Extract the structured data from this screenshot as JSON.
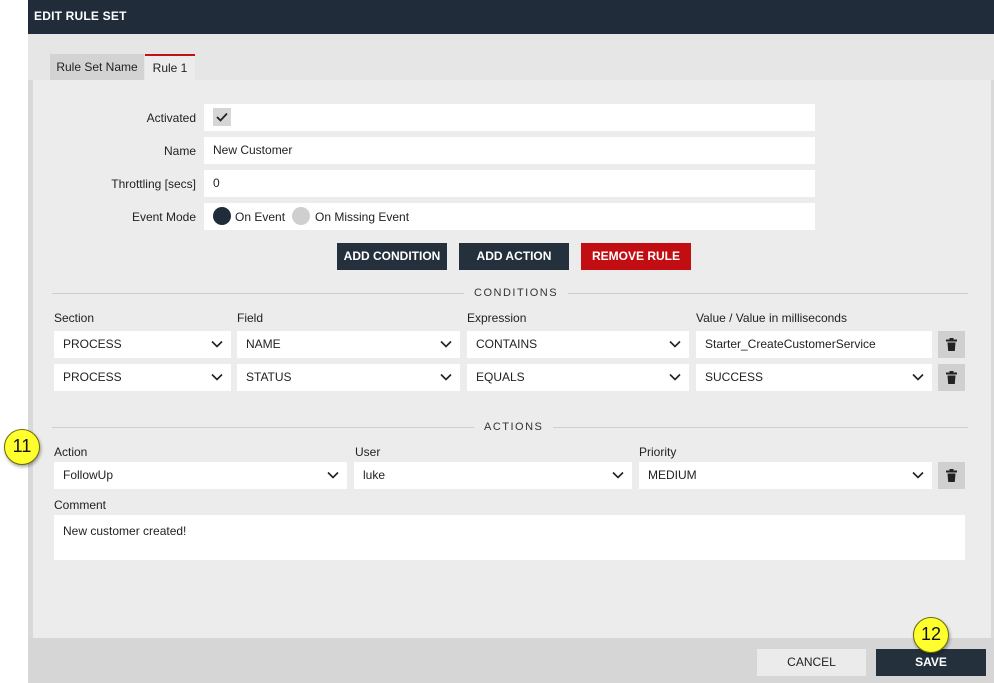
{
  "dialog": {
    "title": "EDIT RULE SET"
  },
  "tabs": [
    {
      "label": "Rule Set Name"
    },
    {
      "label": "Rule 1"
    }
  ],
  "rule": {
    "activated_label": "Activated",
    "name_label": "Name",
    "name_value": "New Customer",
    "throttling_label": "Throttling [secs]",
    "throttling_value": "0",
    "event_mode_label": "Event Mode",
    "event_mode_options": [
      "On Event",
      "On Missing Event"
    ]
  },
  "buttons": {
    "add_condition": "ADD CONDITION",
    "add_action": "ADD ACTION",
    "remove_rule": "REMOVE RULE"
  },
  "conditions": {
    "title": "CONDITIONS",
    "headers": {
      "section": "Section",
      "field": "Field",
      "expression": "Expression",
      "value": "Value / Value in milliseconds"
    },
    "rows": [
      {
        "section": "PROCESS",
        "field": "NAME",
        "expression": "CONTAINS",
        "value": "Starter_CreateCustomerService"
      },
      {
        "section": "PROCESS",
        "field": "STATUS",
        "expression": "EQUALS",
        "value": "SUCCESS"
      }
    ]
  },
  "actions": {
    "title": "ACTIONS",
    "headers": {
      "action": "Action",
      "user": "User",
      "priority": "Priority"
    },
    "row": {
      "action": "FollowUp",
      "user": "luke",
      "priority": "MEDIUM"
    },
    "comment_label": "Comment",
    "comment_value": "New customer created!"
  },
  "footer": {
    "cancel": "CANCEL",
    "save": "SAVE"
  },
  "annotations": {
    "badge_a": "11",
    "badge_b": "12"
  },
  "colors": {
    "titlebar": "#202c39",
    "accent_red": "#c20e13",
    "dark_button": "#24303c",
    "badge": "#ffff2e"
  }
}
